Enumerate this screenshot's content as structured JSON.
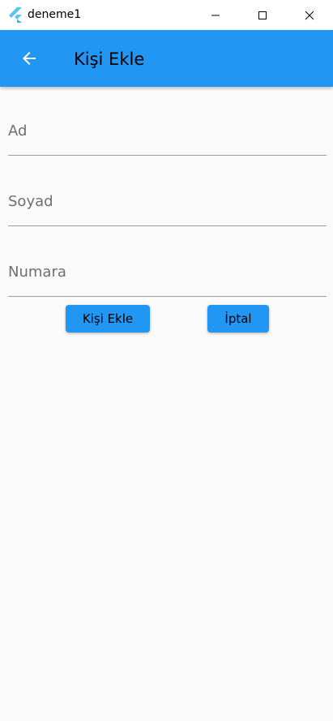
{
  "window": {
    "title": "deneme1",
    "icons": {
      "app": "flutter-logo-icon",
      "minimize": "minimize-icon",
      "maximize": "maximize-icon",
      "close": "close-icon"
    }
  },
  "appbar": {
    "title": "Kişi Ekle",
    "back_icon": "arrow-back-icon",
    "color": "#2196f3"
  },
  "form": {
    "ad": {
      "placeholder": "Ad",
      "value": ""
    },
    "soyad": {
      "placeholder": "Soyad",
      "value": ""
    },
    "numara": {
      "placeholder": "Numara",
      "value": ""
    }
  },
  "buttons": {
    "add_label": "Kişi Ekle",
    "cancel_label": "İptal",
    "color": "#2196f3"
  },
  "colors": {
    "background": "#fafafa",
    "accent": "#2196f3"
  }
}
